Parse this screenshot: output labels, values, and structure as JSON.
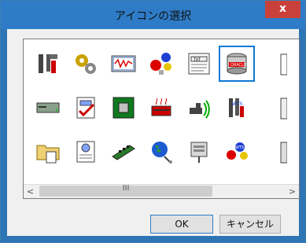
{
  "window": {
    "title": "アイコンの選択",
    "close_label": "x"
  },
  "icons": [
    {
      "name": "tools-icon"
    },
    {
      "name": "gears-icon"
    },
    {
      "name": "monitor-wave-icon"
    },
    {
      "name": "molecule-icon"
    },
    {
      "name": "text-document-icon"
    },
    {
      "name": "oracle-database-icon",
      "selected": true
    },
    {
      "name": "drive-icon"
    },
    {
      "name": "document-check-icon"
    },
    {
      "name": "chip-board-icon"
    },
    {
      "name": "heater-icon"
    },
    {
      "name": "submarine-signal-icon"
    },
    {
      "name": "wts-tools-icon"
    },
    {
      "name": "folder-document-icon"
    },
    {
      "name": "info-document-icon"
    },
    {
      "name": "ram-module-icon"
    },
    {
      "name": "globe-network-icon"
    },
    {
      "name": "network-device-icon"
    },
    {
      "name": "wts-molecule-icon"
    }
  ],
  "scrollbar": {
    "left": "<",
    "right": ">",
    "grip": "III"
  },
  "buttons": {
    "ok": "OK",
    "cancel": "キャンセル"
  }
}
